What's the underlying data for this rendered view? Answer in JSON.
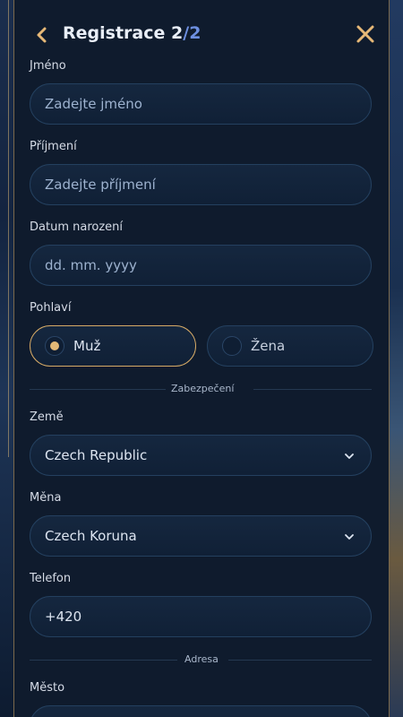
{
  "header": {
    "title": "Registrace",
    "step_current": "2",
    "step_sep": "/",
    "step_total": "2",
    "back_icon": "chevron-left-icon",
    "close_icon": "close-icon"
  },
  "form": {
    "first_name": {
      "label": "Jméno",
      "placeholder": "Zadejte jméno"
    },
    "last_name": {
      "label": "Příjmení",
      "placeholder": "Zadejte příjmení"
    },
    "birth_date": {
      "label": "Datum narození",
      "placeholder": "dd. mm. yyyy"
    },
    "gender": {
      "label": "Pohlaví",
      "options": [
        {
          "label": "Muž",
          "selected": true
        },
        {
          "label": "Žena",
          "selected": false
        }
      ]
    },
    "section_security": "Zabezpečení",
    "country": {
      "label": "Země",
      "value": "Czech Republic"
    },
    "currency": {
      "label": "Měna",
      "value": "Czech Koruna"
    },
    "phone": {
      "label": "Telefon",
      "value": "+420"
    },
    "section_address": "Adresa",
    "city": {
      "label": "Město"
    }
  },
  "colors": {
    "accent_gold": "#d6aa66",
    "accent_blue": "#6d8fe0",
    "panel_bg": "#0f1b2d",
    "field_border": "#24405f"
  }
}
